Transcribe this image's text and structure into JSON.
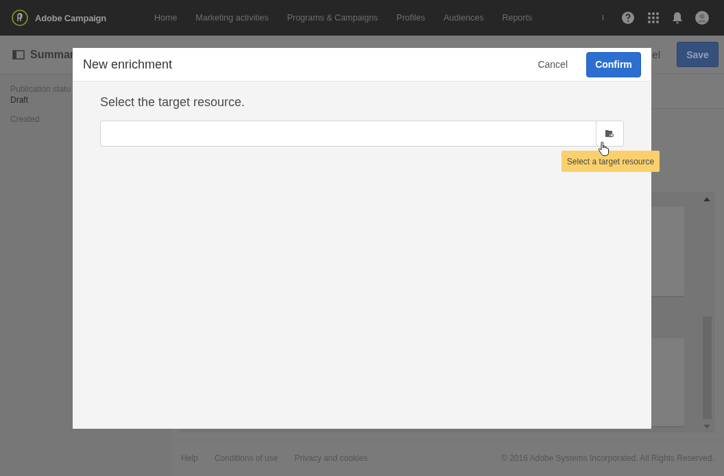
{
  "nav": {
    "brand": "Adobe Campaign",
    "items": [
      "Home",
      "Marketing activities",
      "Programs & Campaigns",
      "Profiles",
      "Audiences",
      "Reports"
    ]
  },
  "page": {
    "title": "Summar",
    "actions": [
      {
        "label": "el",
        "kind": "link"
      },
      {
        "label": "Save",
        "kind": "primary"
      }
    ],
    "sidebar": [
      {
        "label": "Publication statu",
        "value": "Draft"
      },
      {
        "label": "Created"
      }
    ]
  },
  "footer": {
    "links": [
      "Help",
      "Conditions of use",
      "Privacy and cookies"
    ],
    "copyright": "© 2016 Adobe Systems Incorporated. All Rights Reserved."
  },
  "dialog": {
    "title": "New enrichment",
    "cancel": "Cancel",
    "confirm": "Confirm",
    "prompt": "Select the target resource.",
    "tooltip": "Select a target resource"
  }
}
